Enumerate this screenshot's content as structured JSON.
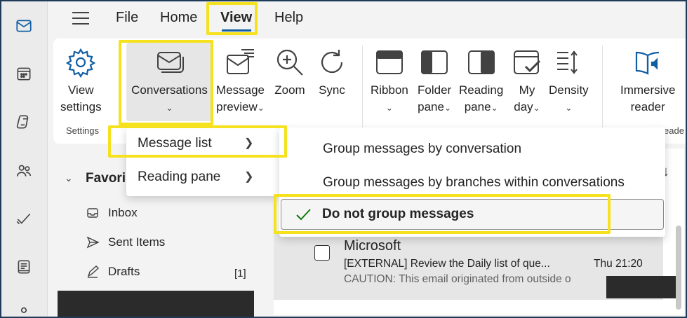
{
  "menubar": {
    "items": [
      "File",
      "Home",
      "View",
      "Help"
    ],
    "active": "View"
  },
  "ribbon": {
    "buttons": [
      {
        "id": "view-settings",
        "line1": "View",
        "line2": "settings",
        "icon": "gear-icon"
      },
      {
        "id": "conversations",
        "line1": "Conversations",
        "line2": "",
        "icon": "conversations-icon"
      },
      {
        "id": "message-preview",
        "line1": "Message",
        "line2": "preview",
        "icon": "message-preview-icon"
      },
      {
        "id": "zoom",
        "line1": "Zoom",
        "line2": "",
        "icon": "zoom-icon"
      },
      {
        "id": "sync",
        "line1": "Sync",
        "line2": "",
        "icon": "sync-icon"
      },
      {
        "id": "ribbon",
        "line1": "Ribbon",
        "line2": "",
        "icon": "ribbon-icon"
      },
      {
        "id": "folder-pane",
        "line1": "Folder",
        "line2": "pane",
        "icon": "folder-pane-icon"
      },
      {
        "id": "reading-pane",
        "line1": "Reading",
        "line2": "pane",
        "icon": "reading-pane-icon"
      },
      {
        "id": "my-day",
        "line1": "My",
        "line2": "day",
        "icon": "calendar-check-icon"
      },
      {
        "id": "density",
        "line1": "Density",
        "line2": "",
        "icon": "density-icon"
      },
      {
        "id": "immersive-reader",
        "line1": "Immersive",
        "line2": "reader",
        "icon": "immersive-reader-icon"
      }
    ],
    "group_settings": "Settings",
    "group_reader": "eade"
  },
  "menu_level1": {
    "items": [
      {
        "label": "Message list"
      },
      {
        "label": "Reading pane"
      }
    ]
  },
  "menu_level2": {
    "items": [
      {
        "label": "Group messages by conversation"
      },
      {
        "label": "Group messages by branches within conversations"
      },
      {
        "label": "Do not group messages",
        "selected": true
      }
    ]
  },
  "folders": {
    "header": "Favori",
    "items": [
      {
        "label": "Inbox",
        "icon": "inbox-icon",
        "count": ""
      },
      {
        "label": "Sent Items",
        "icon": "send-icon",
        "count": ""
      },
      {
        "label": "Drafts",
        "icon": "drafts-icon",
        "count": "[1]"
      }
    ]
  },
  "message": {
    "sender": "Microsoft",
    "subject": "[EXTERNAL] Review the Daily list of que...",
    "time": "Thu 21:20",
    "preview": "CAUTION: This email originated from outside o"
  },
  "colors": {
    "highlight": "#f5e11d",
    "accent": "#115ea3",
    "check": "#107c10"
  }
}
